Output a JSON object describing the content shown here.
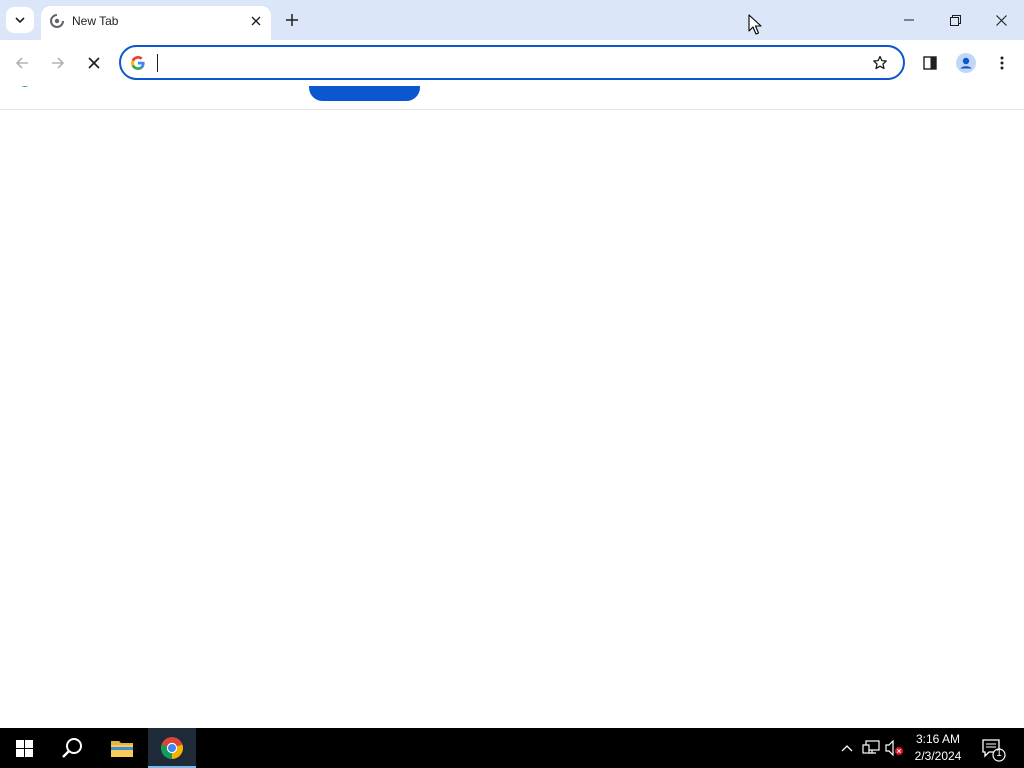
{
  "browser": {
    "tab": {
      "title": "New Tab"
    },
    "omnibox": {
      "value": "",
      "placeholder": ""
    }
  },
  "taskbar": {
    "clock": {
      "time": "3:16 AM",
      "date": "2/3/2024"
    },
    "notification_count": "1"
  },
  "colors": {
    "tabstrip_bg": "#dbe6f8",
    "omnibox_border": "#0b57d0",
    "page_button": "#0b57d0",
    "taskbar_bg": "#000000"
  },
  "icons": [
    "tab-search-icon",
    "tab-favicon-icon",
    "close-icon",
    "plus-icon",
    "minimize-icon",
    "restore-icon",
    "window-close-icon",
    "back-arrow-icon",
    "forward-arrow-icon",
    "stop-loading-icon",
    "google-g-icon",
    "star-icon",
    "side-panel-icon",
    "profile-icon",
    "kebab-menu-icon",
    "windows-start-icon",
    "search-icon",
    "file-explorer-icon",
    "chrome-icon",
    "chevron-up-icon",
    "network-icon",
    "volume-muted-icon",
    "notification-icon"
  ]
}
